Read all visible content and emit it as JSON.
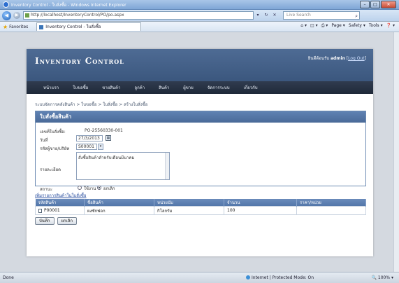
{
  "browser": {
    "window_title": "Inventory Control - ใบสั่งซื้อ - Windows Internet Explorer",
    "address": "http://localhost/InventoryControl/PO/po.aspx",
    "search_placeholder": "Live Search",
    "favorites_label": "Favorites",
    "tab_label": "Inventory Control - ใบสั่งซื้อ",
    "commands": [
      "Page ▾",
      "Safety ▾",
      "Tools ▾",
      "❓ ▾"
    ],
    "status_left": "Done",
    "status_zone": "Internet | Protected Mode: On",
    "zoom": "100%"
  },
  "app": {
    "title": "Inventory Control",
    "user_prefix": "ยินดีต้อนรับ",
    "username": "admin",
    "logout": "Log Out",
    "menu": [
      "หน้าแรก",
      "ใบขอซื้อ",
      "ขายสินค้า",
      "ลูกค้า",
      "สินค้า",
      "ผู้ขาย",
      "จัดการระบบ",
      "เกี่ยวกับ"
    ],
    "breadcrumb": "ระบบจัดการคลังสินค้า > ใบขอซื้อ > ใบสั่งซื้อ > สร้างใบสั่งซื้อ"
  },
  "form": {
    "panel_title": "ใบสั่งซื้อสินค้า",
    "po_number_label": "เลขที่ใบสั่งซื้อ:",
    "po_number_value": "PO-25560330-001",
    "date_label": "วันที่",
    "date_value": "27/3/2013",
    "supplier_label": "รหัสผู้ขาย/บริษัท",
    "supplier_value": "S00001",
    "detail_label": "รายละเอียด",
    "detail_value": "สั่งซื้อสินค้าสำหรับเดือนมีนาคม",
    "status_label": "สถานะ",
    "status_options": [
      "ใช้งาน",
      "ยกเลิก"
    ],
    "status_selected": 1
  },
  "items": {
    "link": "เพิ่มรายการสินค้าในใบสั่งซื้อ",
    "columns": [
      "รหัสสินค้า",
      "ชื่อสินค้า",
      "หน่วยนับ",
      "จำนวน",
      "ราคา/หน่วย"
    ],
    "rows": [
      [
        "P00001",
        "ผงซักฟอก",
        "กิโลกรัม",
        "100",
        ""
      ]
    ]
  },
  "buttons": {
    "save": "บันทึก",
    "cancel": "ยกเลิก"
  },
  "colors": {
    "header": "#3b577e",
    "menubar": "#1f2939",
    "panel_head": "#4a6a98"
  }
}
